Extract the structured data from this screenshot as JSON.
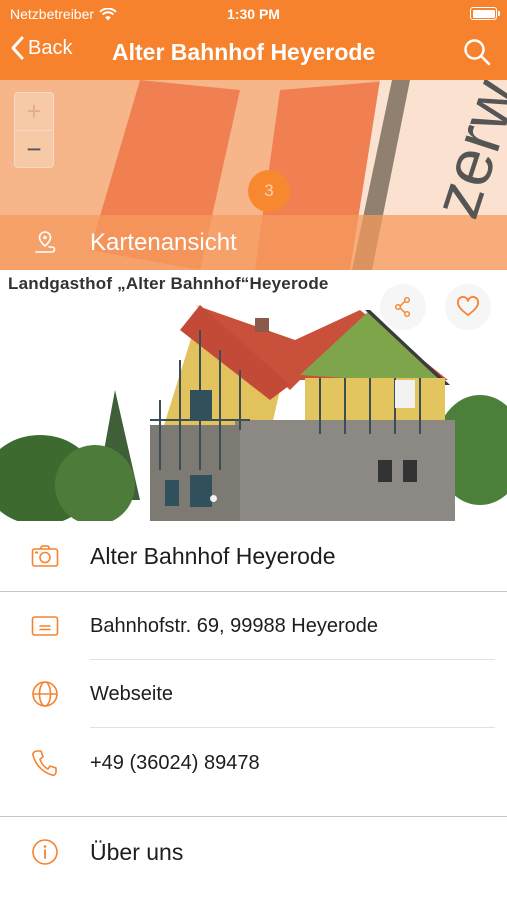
{
  "status_bar": {
    "carrier": "Netzbetreiber",
    "time": "1:30 PM"
  },
  "nav": {
    "back_label": "Back",
    "title": "Alter Bahnhof Heyerode"
  },
  "map": {
    "zoom_in": "+",
    "zoom_out": "−",
    "cluster_count": "3",
    "map_view_label": "Kartenansicht",
    "map_text": "zerw"
  },
  "photo": {
    "caption": "Landgasthof „Alter Bahnhof“Heyerode"
  },
  "details": {
    "name": "Alter Bahnhof Heyerode",
    "address": "Bahnhofstr. 69, 99988 Heyerode",
    "website": "Webseite",
    "phone": "+49 (36024) 89478",
    "about": "Über uns"
  },
  "colors": {
    "accent": "#f7822e",
    "icon": "#f7822e"
  }
}
